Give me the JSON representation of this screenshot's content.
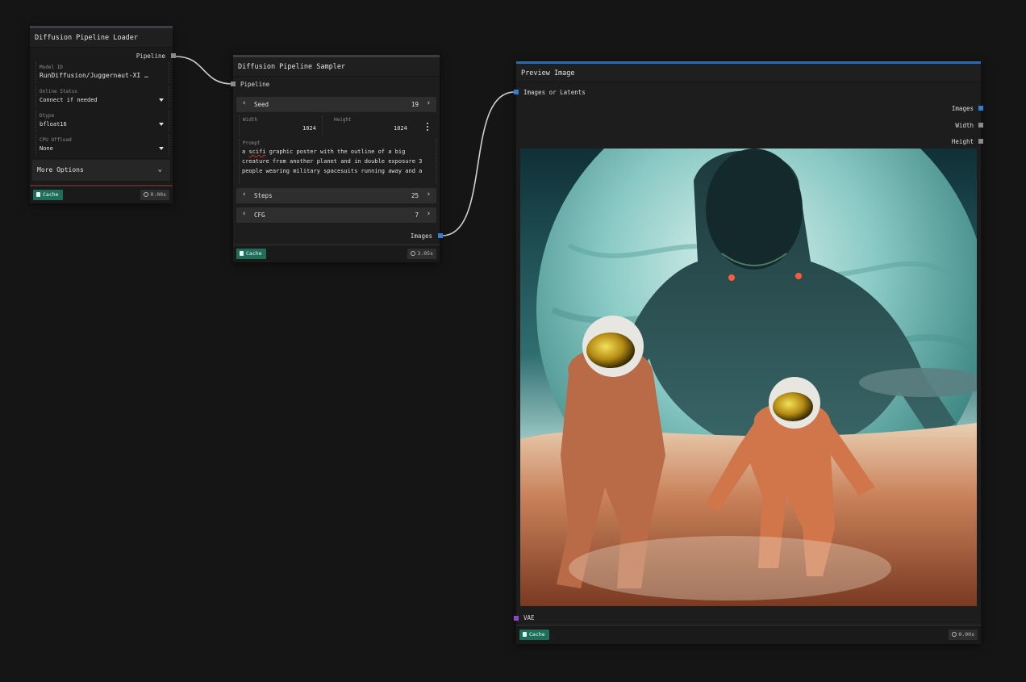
{
  "colors": {
    "canvas_bg": "#151515",
    "node_bg": "#1d1d1d",
    "cache_green": "#1f6e5a",
    "port_grey": "#8a8a8a",
    "port_blue": "#2f7ecf",
    "port_purple": "#8d45c9",
    "wire": "#d0d0d0",
    "preview_accent": "#2b6cb0"
  },
  "loader": {
    "title": "Diffusion Pipeline Loader",
    "output_pipeline": "Pipeline",
    "model_id_label": "Model ID",
    "model_id_value": "RunDiffusion/Juggernaut-XI …",
    "online_status_label": "Online Status",
    "online_status_value": "Connect if needed",
    "dtype_label": "Dtype",
    "dtype_value": "bfloat16",
    "cpu_offload_label": "CPU Offload",
    "cpu_offload_value": "None",
    "more_options": "More Options",
    "cache_label": "Cache",
    "time": "0.00s"
  },
  "sampler": {
    "title": "Diffusion Pipeline Sampler",
    "input_pipeline": "Pipeline",
    "seed_label": "Seed",
    "seed_value": "19",
    "width_label": "Width",
    "width_value": "1024",
    "height_label": "Height",
    "height_value": "1024",
    "prompt_label": "Prompt",
    "prompt_word1": "a ",
    "prompt_misspelled": "scifi",
    "prompt_rest": " graphic poster with the outline of a big creature from another planet and in double exposure 3 people wearing military spacesuits running away and a",
    "steps_label": "Steps",
    "steps_value": "25",
    "cfg_label": "CFG",
    "cfg_value": "7",
    "output_images": "Images",
    "cache_label": "Cache",
    "time": "3.05s"
  },
  "preview": {
    "title": "Preview Image",
    "input_images_or_latents": "Images or Latents",
    "output_images": "Images",
    "output_width": "Width",
    "output_height": "Height",
    "input_vae": "VAE",
    "cache_label": "Cache",
    "time": "0.00s"
  }
}
